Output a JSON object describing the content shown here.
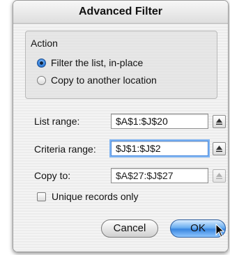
{
  "dialog": {
    "title": "Advanced Filter"
  },
  "action": {
    "label": "Action",
    "options": [
      {
        "label": "Filter the list, in-place",
        "selected": true
      },
      {
        "label": "Copy to another location",
        "selected": false
      }
    ]
  },
  "fields": {
    "list_range": {
      "label": "List range:",
      "value": "$A$1:$J$20"
    },
    "criteria_range": {
      "label": "Criteria range:",
      "value": "$J$1:$J$2"
    },
    "copy_to": {
      "label": "Copy to:",
      "value": "$A$27:$J$27"
    }
  },
  "unique_records": {
    "label": "Unique records only",
    "checked": false
  },
  "buttons": {
    "cancel": "Cancel",
    "ok": "OK"
  },
  "colors": {
    "accent": "#3a86e0",
    "focus_ring": "#7fb4f2"
  },
  "icons": {
    "collapse": "collapse-dialog-icon",
    "cursor": "mouse-pointer-icon"
  }
}
